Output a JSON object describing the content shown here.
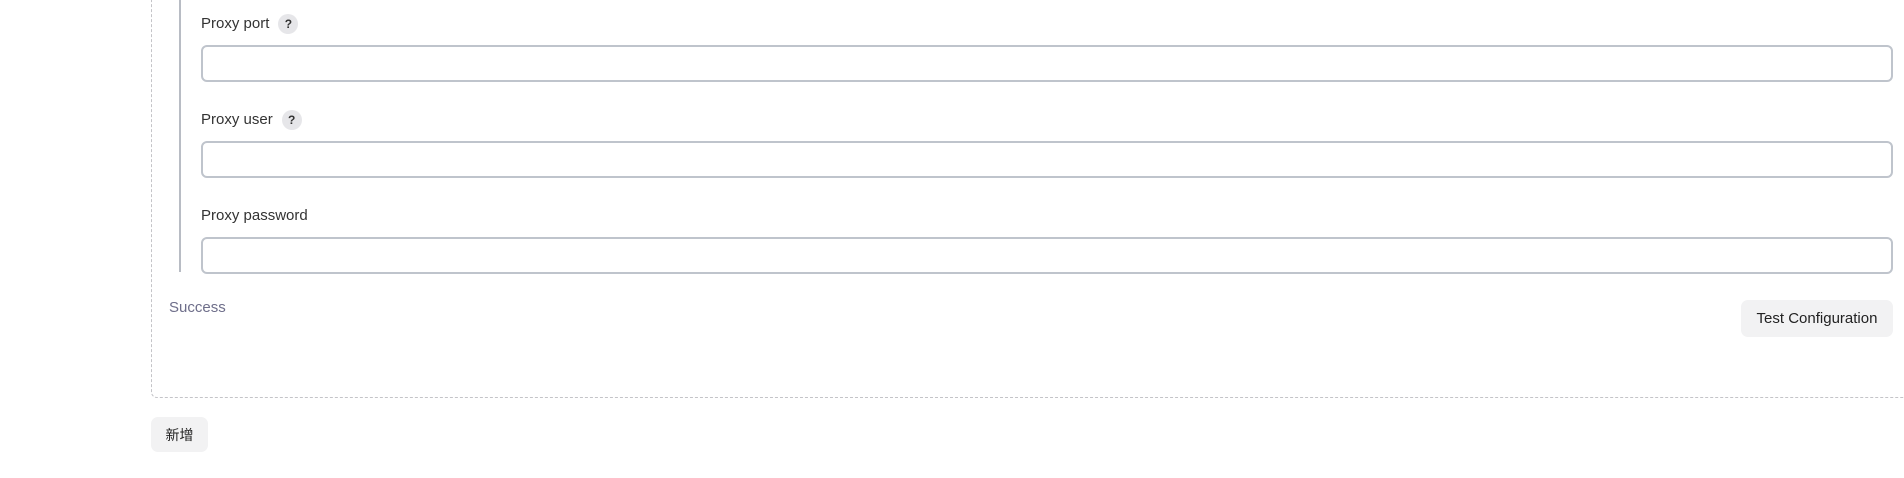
{
  "fields": [
    {
      "label": "Proxy port",
      "help_icon": "question-mark",
      "value": ""
    },
    {
      "label": "Proxy user",
      "help_icon": "question-mark",
      "value": ""
    },
    {
      "label": "Proxy password",
      "value": ""
    }
  ],
  "help_glyph": "?",
  "status_text": "Success",
  "test_button_label": "Test Configuration",
  "add_button_label": "新增"
}
